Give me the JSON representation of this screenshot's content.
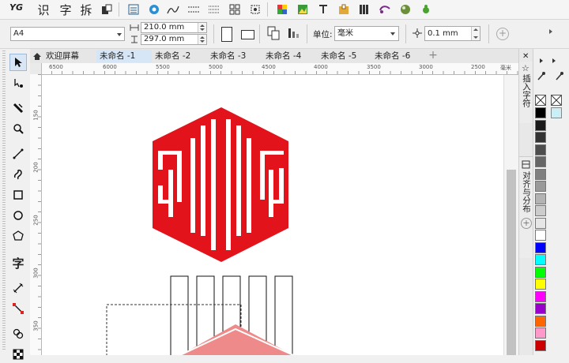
{
  "toolbar": {
    "text_buttons": [
      "识",
      "字",
      "拆"
    ],
    "logo_text": "YG"
  },
  "property_bar": {
    "page_size": "A4",
    "width": "210.0 mm",
    "height": "297.0 mm",
    "units_label": "单位:",
    "units_value": "毫米",
    "nudge": "0.1 mm"
  },
  "tabs": [
    "欢迎屏幕",
    "未命名 -1",
    "未命名 -2",
    "未命名 -3",
    "未命名 -4",
    "未命名 -5",
    "未命名 -6"
  ],
  "ruler": {
    "h_labels": [
      "6500",
      "6000",
      "5500",
      "5000",
      "4500",
      "4000",
      "3500",
      "3000",
      "2500"
    ],
    "unit": "毫米",
    "v_labels": [
      "150",
      "200",
      "250",
      "300",
      "350",
      "400"
    ]
  },
  "toolbox": {
    "text_tool": "字"
  },
  "dockers": {
    "insert_char": "插入字符",
    "align": "对齐与分布"
  },
  "palette": [
    "#000000",
    "#1a1a1a",
    "#333333",
    "#4d4d4d",
    "#666666",
    "#808080",
    "#999999",
    "#b3b3b3",
    "#cccccc",
    "#e6e6e6",
    "#ffffff",
    "#0000ff",
    "#00ffff",
    "#00ff00",
    "#ffff00",
    "#ff00ff",
    "#9900cc",
    "#ff6600",
    "#ff99cc",
    "#cc0000"
  ],
  "colors": {
    "logo_red": "#e3131b",
    "accent": "#2b6cb0"
  }
}
